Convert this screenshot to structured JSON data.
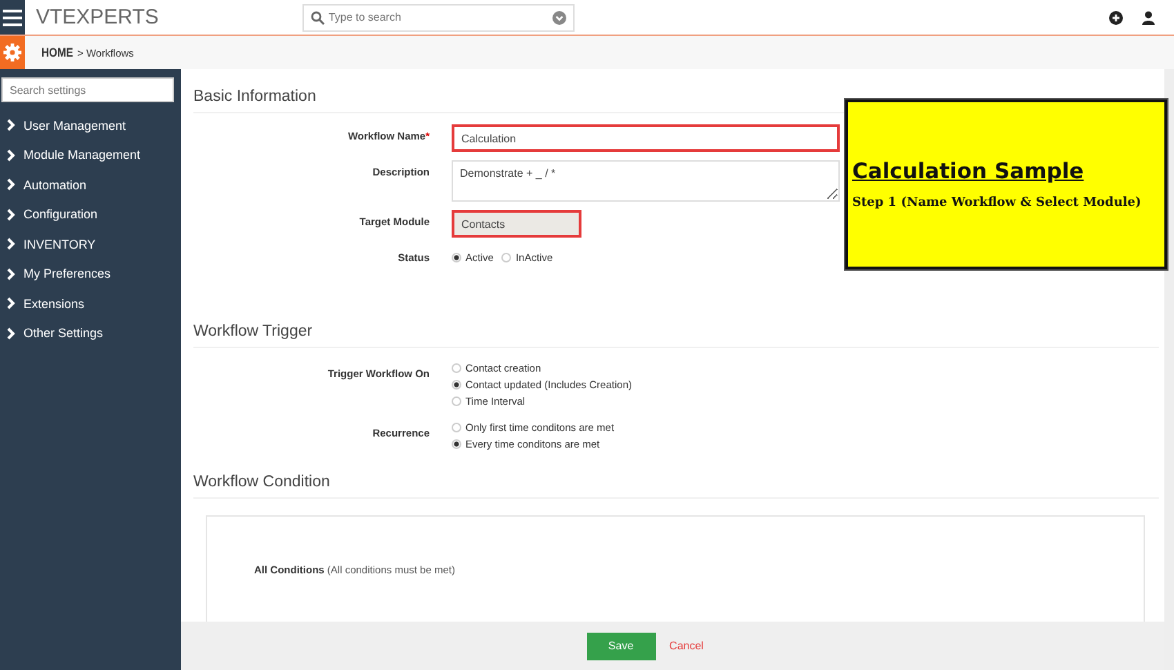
{
  "header": {
    "logo": "VTEXPERTS",
    "search": {
      "placeholder": "Type to search"
    }
  },
  "breadcrumb": {
    "home": "HOME",
    "current": "> Workflows"
  },
  "sidebar": {
    "search": {
      "placeholder": "Search settings"
    },
    "items": [
      {
        "label": "User Management"
      },
      {
        "label": "Module Management"
      },
      {
        "label": "Automation"
      },
      {
        "label": "Configuration"
      },
      {
        "label": "INVENTORY"
      },
      {
        "label": "My Preferences"
      },
      {
        "label": "Extensions"
      },
      {
        "label": "Other Settings"
      }
    ]
  },
  "basic": {
    "title": "Basic Information",
    "name_label": "Workflow Name",
    "required": "*",
    "name_value": "Calculation",
    "description_label": "Description",
    "description_value": "Demonstrate + _ / *",
    "module_label": "Target Module",
    "module_value": "Contacts",
    "status_label": "Status",
    "status_options": [
      {
        "label": "Active",
        "selected": true
      },
      {
        "label": "InActive",
        "selected": false
      }
    ]
  },
  "trigger": {
    "title": "Workflow Trigger",
    "on_label": "Trigger Workflow On",
    "on_options": [
      {
        "label": "Contact creation",
        "selected": false
      },
      {
        "label": "Contact updated  (Includes Creation)",
        "selected": true
      },
      {
        "label": "Time Interval",
        "selected": false
      }
    ],
    "recurrence_label": "Recurrence",
    "recurrence_options": [
      {
        "label": "Only first time conditons are met",
        "selected": false
      },
      {
        "label": "Every time conditons are met",
        "selected": true
      }
    ]
  },
  "condition": {
    "title": "Workflow Condition",
    "all_label": "All Conditions",
    "all_note": "(All conditions must be met)"
  },
  "callout": {
    "title": "Calculation Sample",
    "subtitle": "Step 1 (Name Workflow & Select Module)"
  },
  "footer": {
    "save": "Save",
    "cancel": "Cancel"
  }
}
